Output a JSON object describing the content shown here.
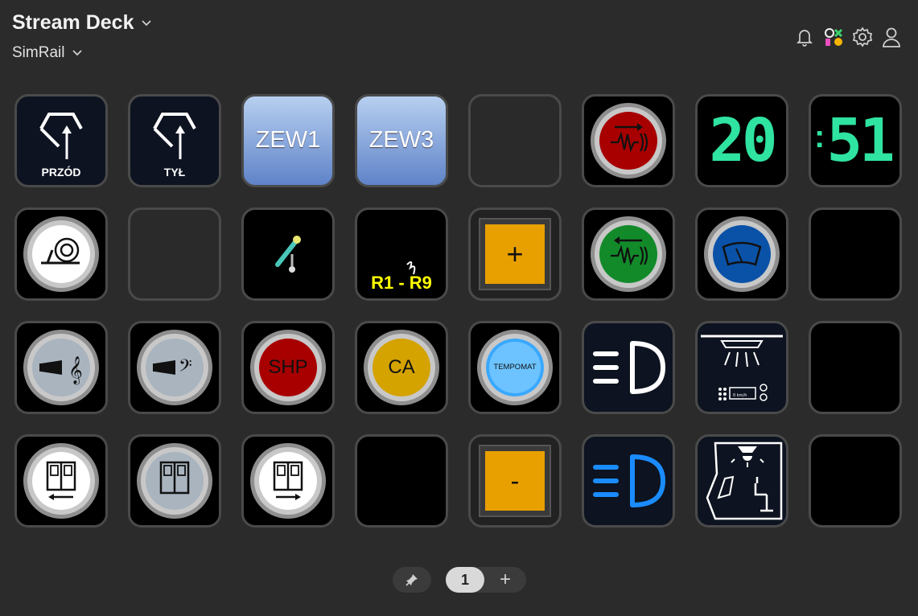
{
  "header": {
    "device_name": "Stream Deck",
    "profile_name": "SimRail",
    "icons": [
      "bell-icon",
      "marketplace-icon",
      "gear-icon",
      "user-icon"
    ]
  },
  "keys": {
    "przod": "PRZÓD",
    "tyl": "TYŁ",
    "zew1": "ZEW1",
    "zew3": "ZEW3",
    "clock_hours": "20",
    "clock_minutes": "51",
    "r1r9": "R1 - R9",
    "plus": "+",
    "shp": "SHP",
    "ca": "CA",
    "tempomat": "TEMPOMAT",
    "minus": "-",
    "speed_small": "0 km/h"
  },
  "colors": {
    "red_button": "#a80000",
    "green_button": "#128a2a",
    "blue_button": "#0a52a8",
    "amber_button": "#e8a000",
    "zew_gradient_top": "#b7cff0",
    "zew_gradient_bottom": "#5f83c8",
    "clock_digits": "#2fe3a0",
    "lights_blue": "#1b8cff"
  },
  "pager": {
    "current_page": "1",
    "add_label": "+"
  }
}
